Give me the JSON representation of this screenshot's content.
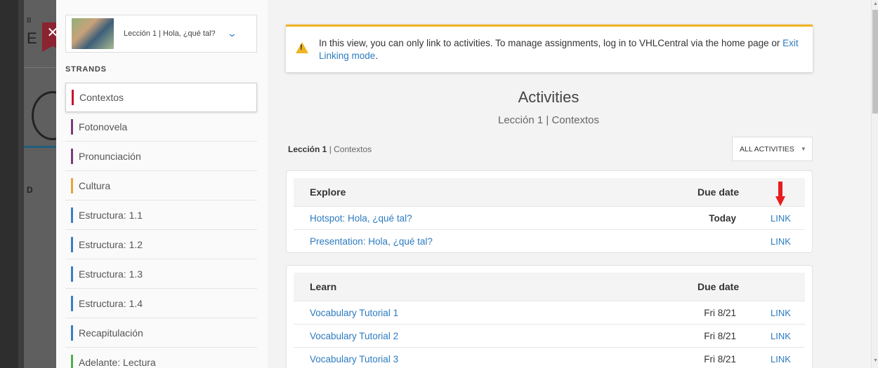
{
  "background_page": {
    "fragments": [
      "B",
      "E",
      "D"
    ]
  },
  "close_button": {
    "label": "✕"
  },
  "sidebar": {
    "lesson_select": {
      "label": "Lección 1 | Hola, ¿qué tal?",
      "chevron": "⌄"
    },
    "strands_heading": "STRANDS",
    "strands": [
      {
        "label": "Contextos",
        "color": "#c8102e",
        "active": true
      },
      {
        "label": "Fotonovela",
        "color": "#7a3b7f"
      },
      {
        "label": "Pronunciación",
        "color": "#7a3b7f"
      },
      {
        "label": "Cultura",
        "color": "#e8a33d"
      },
      {
        "label": "Estructura: 1.1",
        "color": "#3a7fc1"
      },
      {
        "label": "Estructura: 1.2",
        "color": "#3a7fc1"
      },
      {
        "label": "Estructura: 1.3",
        "color": "#3a7fc1"
      },
      {
        "label": "Estructura: 1.4",
        "color": "#3a7fc1"
      },
      {
        "label": "Recapitulación",
        "color": "#3a7fc1"
      },
      {
        "label": "Adelante: Lectura",
        "color": "#4caf50"
      }
    ]
  },
  "alert": {
    "icon": "warning-icon",
    "text": "In this view, you can only link to activities. To manage assignments, log in to VHLCentral via the home page or ",
    "link": "Exit Linking mode",
    "suffix": "."
  },
  "activities": {
    "title": "Activities",
    "subtitle": "Lección 1 | Contextos",
    "breadcrumb_bold": "Lección 1",
    "breadcrumb_rest": " | Contextos",
    "filter_label": "ALL ACTIVITIES",
    "filter_caret": "▼",
    "sections": [
      {
        "title": "Explore",
        "due_header": "Due date",
        "rows": [
          {
            "name": "Hotspot: Hola, ¿qué tal?",
            "due": "Today",
            "link": "LINK"
          },
          {
            "name": "Presentation: Hola, ¿qué tal?",
            "due": "",
            "link": "LINK"
          }
        ]
      },
      {
        "title": "Learn",
        "due_header": "Due date",
        "rows": [
          {
            "name": "Vocabulary Tutorial 1",
            "due": "Fri 8/21",
            "link": "LINK"
          },
          {
            "name": "Vocabulary Tutorial 2",
            "due": "Fri 8/21",
            "link": "LINK"
          },
          {
            "name": "Vocabulary Tutorial 3",
            "due": "Fri 8/21",
            "link": "LINK"
          }
        ]
      }
    ]
  },
  "scrollbar": {
    "up": "▲",
    "down": "▼"
  }
}
